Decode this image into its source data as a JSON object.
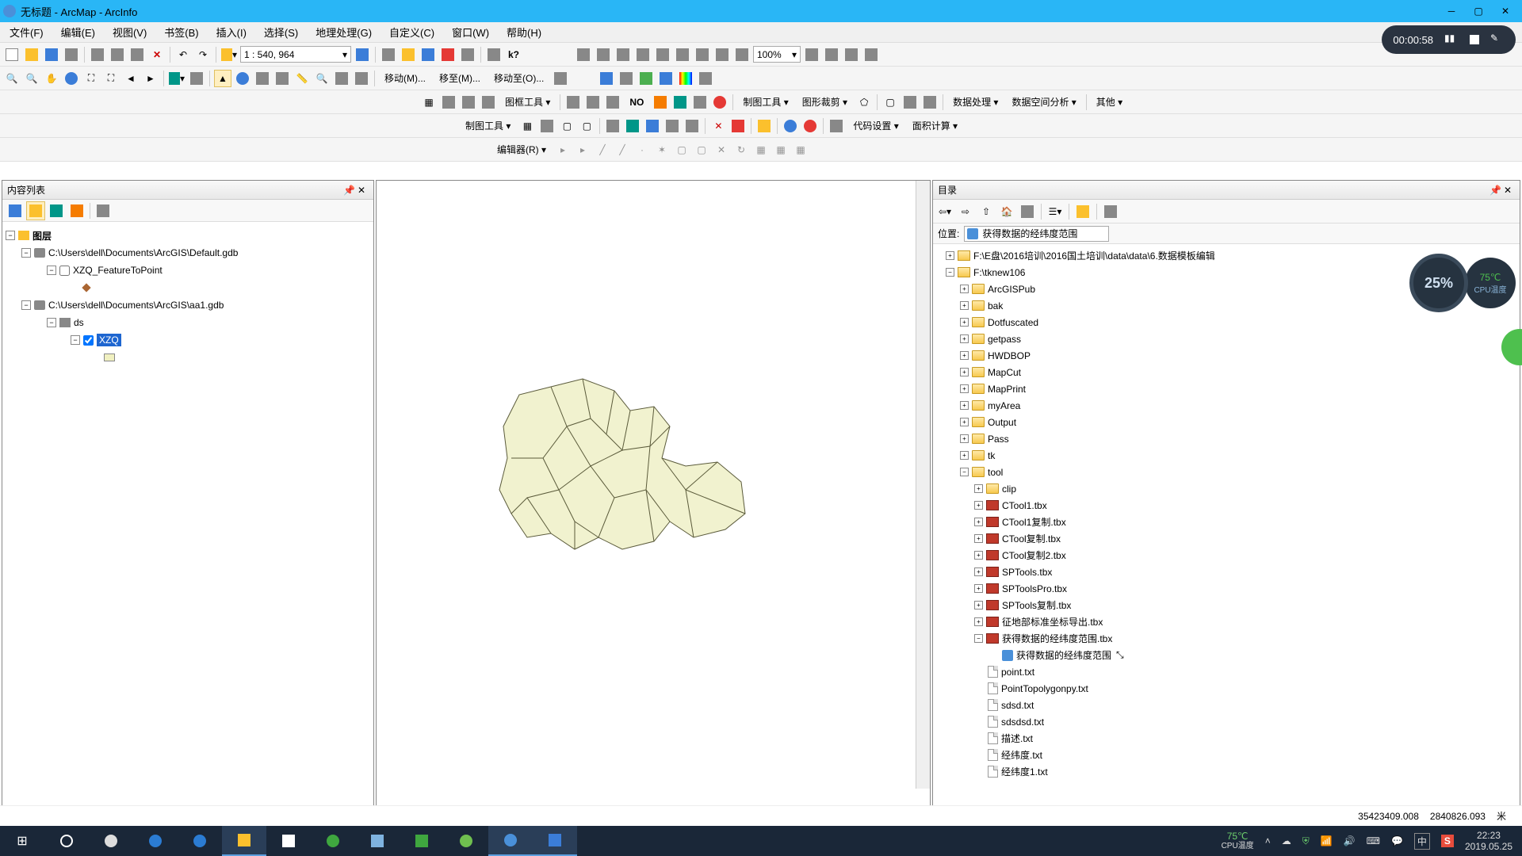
{
  "title": "无标题 - ArcMap - ArcInfo",
  "menu": [
    "文件(F)",
    "编辑(E)",
    "视图(V)",
    "书签(B)",
    "插入(I)",
    "选择(S)",
    "地理处理(G)",
    "自定义(C)",
    "窗口(W)",
    "帮助(H)"
  ],
  "scale_value": "1 : 540, 964",
  "zoom_pct": "100%",
  "move_buttons": [
    "移动(M)...",
    "移至(M)...",
    "移动至(O)..."
  ],
  "toolbar3": {
    "tuakuang": "图框工具 ▾",
    "no": "NO",
    "zhitu": "制图工具 ▾",
    "tuxing": "图形裁剪 ▾",
    "shuju": "数据处理 ▾",
    "kongjian": "数据空间分析 ▾",
    "qita": "其他 ▾"
  },
  "toolbar4": {
    "zhitu": "制图工具 ▾",
    "daima": "代码设置 ▾",
    "mianji": "面积计算 ▾"
  },
  "toolbar5": {
    "editor": "编辑器(R) ▾"
  },
  "recording": {
    "time": "00:00:58"
  },
  "gauge": {
    "pct": "25%",
    "temp": "75℃",
    "label": "CPU温度"
  },
  "toc": {
    "title": "内容列表",
    "root": "图层",
    "gdb1": "C:\\Users\\dell\\Documents\\ArcGIS\\Default.gdb",
    "layer1": "XZQ_FeatureToPoint",
    "gdb2": "C:\\Users\\dell\\Documents\\ArcGIS\\aa1.gdb",
    "ds": "ds",
    "layer2": "XZQ"
  },
  "catalog": {
    "title": "目录",
    "location_label": "位置:",
    "location_value": "获得数据的经纬度范围",
    "root1": "F:\\E盘\\2016培训\\2016国土培训\\data\\data\\6.数据模板编辑",
    "root2": "F:\\tknew106",
    "folders": [
      "ArcGISPub",
      "bak",
      "Dotfuscated",
      "getpass",
      "HWDBOP",
      "MapCut",
      "MapPrint",
      "myArea",
      "Output",
      "Pass",
      "tk",
      "tool"
    ],
    "tool_folder": "clip",
    "toolboxes": [
      "CTool1.tbx",
      "CTool1复制.tbx",
      "CTool复制.tbx",
      "CTool复制2.tbx",
      "SPTools.tbx",
      "SPToolsPro.tbx",
      "SPTools复制.tbx",
      "征地部标准坐标导出.tbx",
      "获得数据的经纬度范围.tbx"
    ],
    "tool_item": "获得数据的经纬度范围",
    "textfiles": [
      "point.txt",
      "PointTopolygonpy.txt",
      "sdsd.txt",
      "sdsdsd.txt",
      "描述.txt",
      "经纬度.txt",
      "经纬度1.txt"
    ]
  },
  "status": {
    "x": "35423409.008",
    "y": "2840826.093",
    "unit": "米"
  },
  "taskbar": {
    "temp": "75℃",
    "templabel": "CPU温度",
    "time": "22:23",
    "date": "2019.05.25",
    "ime": "中"
  }
}
